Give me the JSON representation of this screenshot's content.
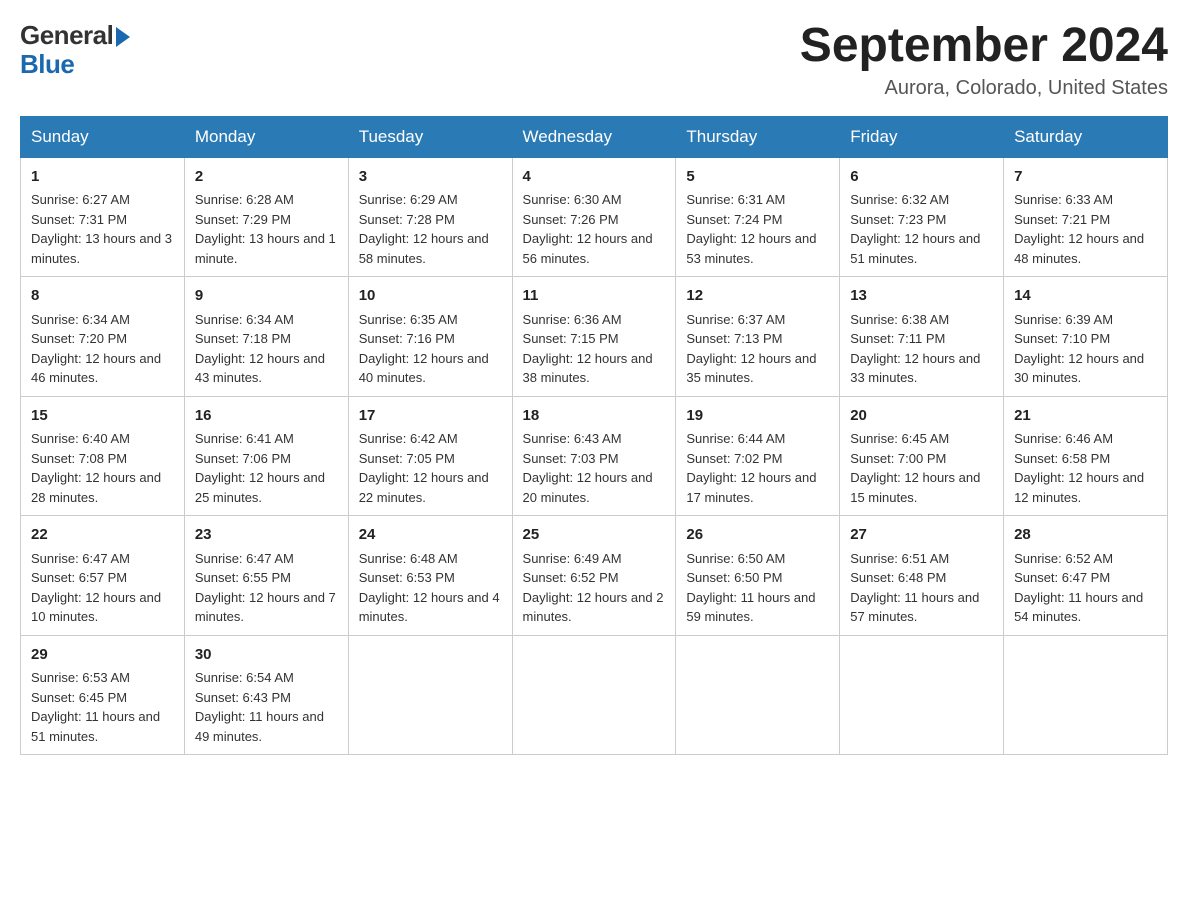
{
  "header": {
    "logo_general": "General",
    "logo_blue": "Blue",
    "month_title": "September 2024",
    "location": "Aurora, Colorado, United States"
  },
  "days_of_week": [
    "Sunday",
    "Monday",
    "Tuesday",
    "Wednesday",
    "Thursday",
    "Friday",
    "Saturday"
  ],
  "weeks": [
    [
      {
        "day": "1",
        "sunrise": "6:27 AM",
        "sunset": "7:31 PM",
        "daylight": "13 hours and 3 minutes."
      },
      {
        "day": "2",
        "sunrise": "6:28 AM",
        "sunset": "7:29 PM",
        "daylight": "13 hours and 1 minute."
      },
      {
        "day": "3",
        "sunrise": "6:29 AM",
        "sunset": "7:28 PM",
        "daylight": "12 hours and 58 minutes."
      },
      {
        "day": "4",
        "sunrise": "6:30 AM",
        "sunset": "7:26 PM",
        "daylight": "12 hours and 56 minutes."
      },
      {
        "day": "5",
        "sunrise": "6:31 AM",
        "sunset": "7:24 PM",
        "daylight": "12 hours and 53 minutes."
      },
      {
        "day": "6",
        "sunrise": "6:32 AM",
        "sunset": "7:23 PM",
        "daylight": "12 hours and 51 minutes."
      },
      {
        "day": "7",
        "sunrise": "6:33 AM",
        "sunset": "7:21 PM",
        "daylight": "12 hours and 48 minutes."
      }
    ],
    [
      {
        "day": "8",
        "sunrise": "6:34 AM",
        "sunset": "7:20 PM",
        "daylight": "12 hours and 46 minutes."
      },
      {
        "day": "9",
        "sunrise": "6:34 AM",
        "sunset": "7:18 PM",
        "daylight": "12 hours and 43 minutes."
      },
      {
        "day": "10",
        "sunrise": "6:35 AM",
        "sunset": "7:16 PM",
        "daylight": "12 hours and 40 minutes."
      },
      {
        "day": "11",
        "sunrise": "6:36 AM",
        "sunset": "7:15 PM",
        "daylight": "12 hours and 38 minutes."
      },
      {
        "day": "12",
        "sunrise": "6:37 AM",
        "sunset": "7:13 PM",
        "daylight": "12 hours and 35 minutes."
      },
      {
        "day": "13",
        "sunrise": "6:38 AM",
        "sunset": "7:11 PM",
        "daylight": "12 hours and 33 minutes."
      },
      {
        "day": "14",
        "sunrise": "6:39 AM",
        "sunset": "7:10 PM",
        "daylight": "12 hours and 30 minutes."
      }
    ],
    [
      {
        "day": "15",
        "sunrise": "6:40 AM",
        "sunset": "7:08 PM",
        "daylight": "12 hours and 28 minutes."
      },
      {
        "day": "16",
        "sunrise": "6:41 AM",
        "sunset": "7:06 PM",
        "daylight": "12 hours and 25 minutes."
      },
      {
        "day": "17",
        "sunrise": "6:42 AM",
        "sunset": "7:05 PM",
        "daylight": "12 hours and 22 minutes."
      },
      {
        "day": "18",
        "sunrise": "6:43 AM",
        "sunset": "7:03 PM",
        "daylight": "12 hours and 20 minutes."
      },
      {
        "day": "19",
        "sunrise": "6:44 AM",
        "sunset": "7:02 PM",
        "daylight": "12 hours and 17 minutes."
      },
      {
        "day": "20",
        "sunrise": "6:45 AM",
        "sunset": "7:00 PM",
        "daylight": "12 hours and 15 minutes."
      },
      {
        "day": "21",
        "sunrise": "6:46 AM",
        "sunset": "6:58 PM",
        "daylight": "12 hours and 12 minutes."
      }
    ],
    [
      {
        "day": "22",
        "sunrise": "6:47 AM",
        "sunset": "6:57 PM",
        "daylight": "12 hours and 10 minutes."
      },
      {
        "day": "23",
        "sunrise": "6:47 AM",
        "sunset": "6:55 PM",
        "daylight": "12 hours and 7 minutes."
      },
      {
        "day": "24",
        "sunrise": "6:48 AM",
        "sunset": "6:53 PM",
        "daylight": "12 hours and 4 minutes."
      },
      {
        "day": "25",
        "sunrise": "6:49 AM",
        "sunset": "6:52 PM",
        "daylight": "12 hours and 2 minutes."
      },
      {
        "day": "26",
        "sunrise": "6:50 AM",
        "sunset": "6:50 PM",
        "daylight": "11 hours and 59 minutes."
      },
      {
        "day": "27",
        "sunrise": "6:51 AM",
        "sunset": "6:48 PM",
        "daylight": "11 hours and 57 minutes."
      },
      {
        "day": "28",
        "sunrise": "6:52 AM",
        "sunset": "6:47 PM",
        "daylight": "11 hours and 54 minutes."
      }
    ],
    [
      {
        "day": "29",
        "sunrise": "6:53 AM",
        "sunset": "6:45 PM",
        "daylight": "11 hours and 51 minutes."
      },
      {
        "day": "30",
        "sunrise": "6:54 AM",
        "sunset": "6:43 PM",
        "daylight": "11 hours and 49 minutes."
      },
      null,
      null,
      null,
      null,
      null
    ]
  ]
}
